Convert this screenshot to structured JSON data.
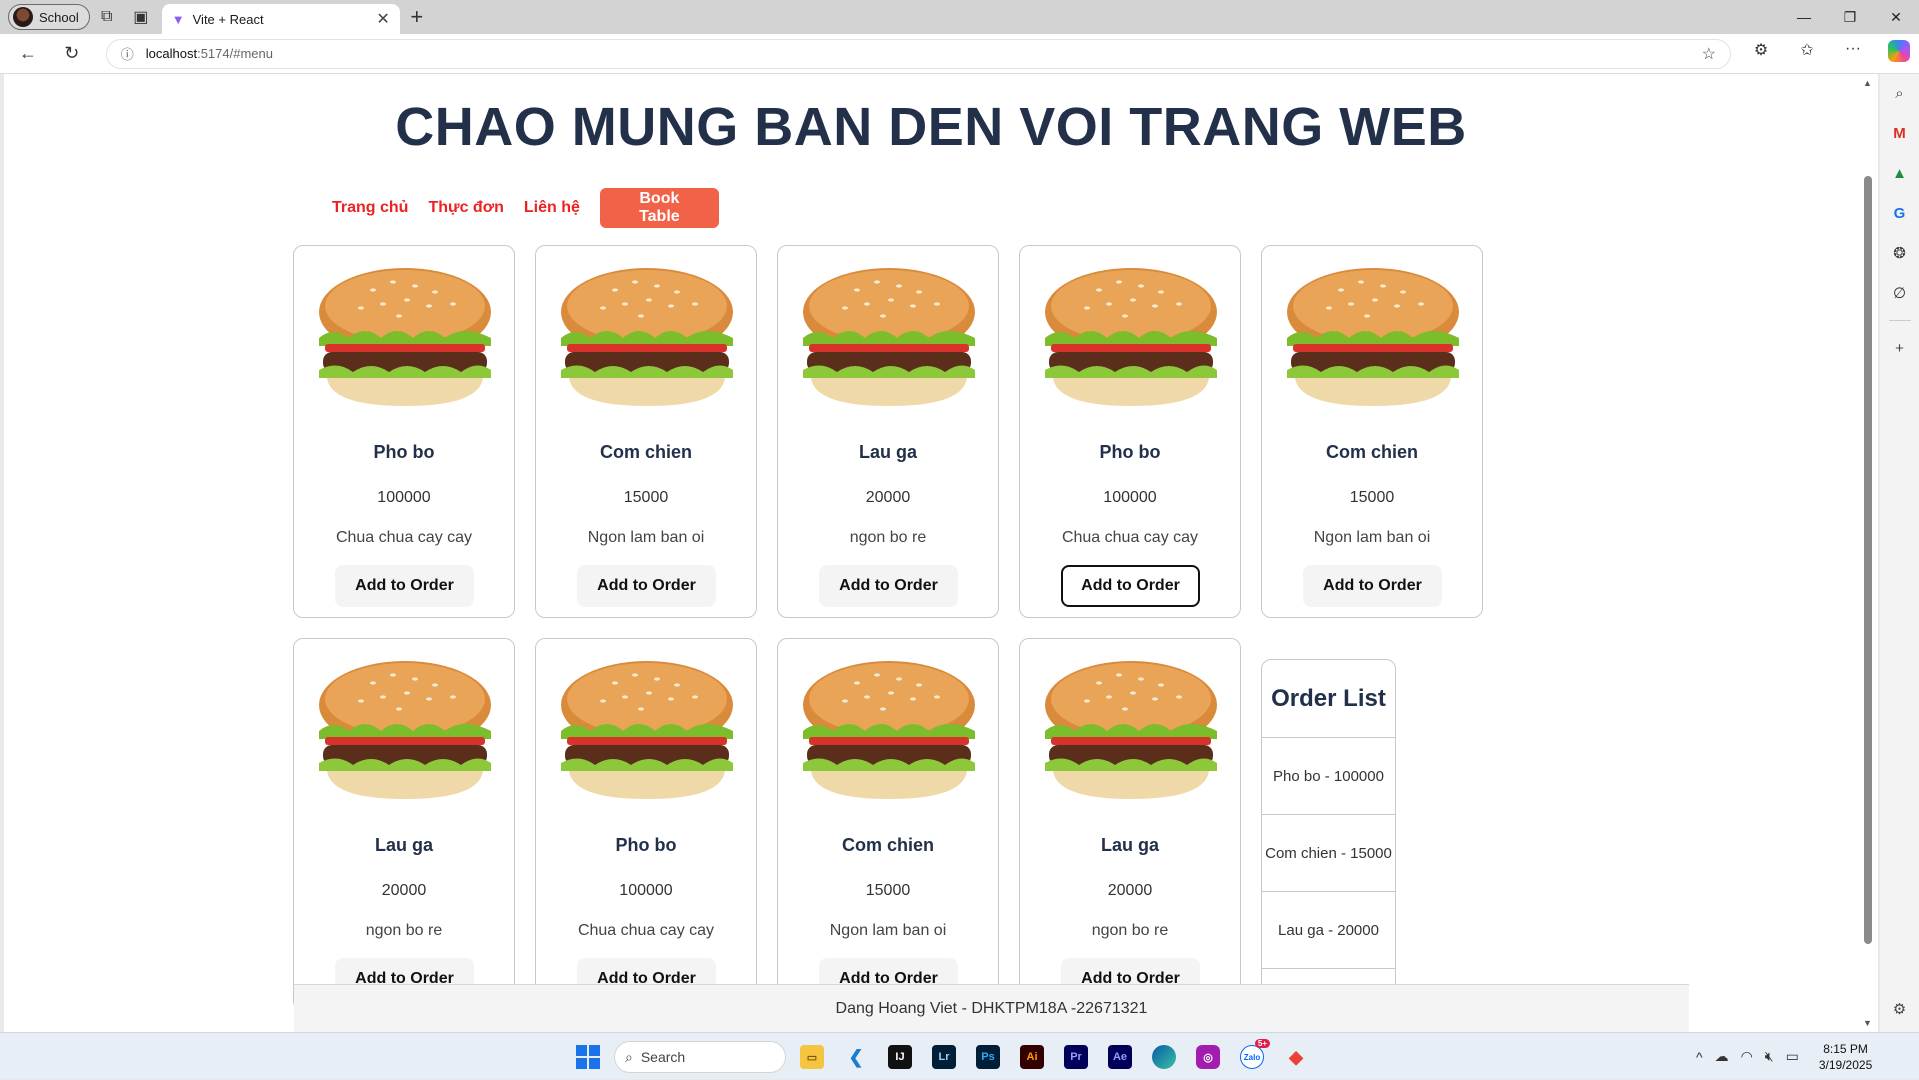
{
  "browser": {
    "profile_label": "School",
    "tab_title": "Vite + React",
    "url_host": "localhost",
    "url_path": ":5174/#menu"
  },
  "page": {
    "title": "CHAO MUNG BAN DEN VOI TRANG WEB",
    "nav": {
      "home": "Trang chủ",
      "menu": "Thực đơn",
      "contact": "Liên hệ",
      "book_table": "Book Table"
    },
    "items": [
      {
        "name": "Pho bo",
        "price": "100000",
        "desc": "Chua chua cay cay",
        "button": "Add to Order"
      },
      {
        "name": "Com chien",
        "price": "15000",
        "desc": "Ngon lam ban oi",
        "button": "Add to Order"
      },
      {
        "name": "Lau ga",
        "price": "20000",
        "desc": "ngon bo re",
        "button": "Add to Order"
      },
      {
        "name": "Pho bo",
        "price": "100000",
        "desc": "Chua chua cay cay",
        "button": "Add to Order"
      },
      {
        "name": "Com chien",
        "price": "15000",
        "desc": "Ngon lam ban oi",
        "button": "Add to Order"
      },
      {
        "name": "Lau ga",
        "price": "20000",
        "desc": "ngon bo re",
        "button": "Add to Order"
      },
      {
        "name": "Pho bo",
        "price": "100000",
        "desc": "Chua chua cay cay",
        "button": "Add to Order"
      },
      {
        "name": "Com chien",
        "price": "15000",
        "desc": "Ngon lam ban oi",
        "button": "Add to Order"
      },
      {
        "name": "Lau ga",
        "price": "20000",
        "desc": "ngon bo re",
        "button": "Add to Order"
      }
    ],
    "order_list": {
      "title": "Order List",
      "entries": [
        "Pho bo - 100000",
        "Com chien - 15000",
        "Lau ga - 20000"
      ]
    },
    "footer": "Dang Hoang Viet - DHKTPM18A -22671321"
  },
  "taskbar": {
    "search_placeholder": "Search",
    "time": "8:15 PM",
    "date": "3/19/2025",
    "zalo_badge": "5+"
  },
  "colors": {
    "nav_link": "#ee2222",
    "book_button": "#f26248",
    "heading": "#22304a"
  }
}
